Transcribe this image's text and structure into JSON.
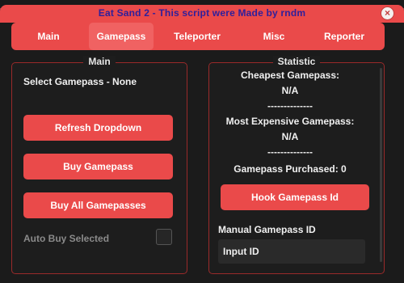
{
  "window": {
    "title": "Eat Sand 2 - This script were Made by rndm",
    "close_icon": "×"
  },
  "tabs": [
    {
      "label": "Main",
      "active": false
    },
    {
      "label": "Gamepass",
      "active": true
    },
    {
      "label": "Teleporter",
      "active": false
    },
    {
      "label": "Misc",
      "active": false
    },
    {
      "label": "Reporter",
      "active": false
    }
  ],
  "main_panel": {
    "title": "Main",
    "select_label": "Select Gamepass - None",
    "refresh_button": "Refresh Dropdown",
    "buy_button": "Buy Gamepass",
    "buy_all_button": "Buy All Gamepasses",
    "auto_buy_label": "Auto Buy Selected",
    "auto_buy_checked": false
  },
  "statistic_panel": {
    "title": "Statistic",
    "cheapest_label": "Cheapest Gamepass:",
    "cheapest_value": "N/A",
    "separator": "--------------",
    "most_expensive_label": "Most Expensive Gamepass:",
    "most_expensive_value": "N/A",
    "separator_2": "--------------",
    "purchased_label": "Gamepass Purchased: 0",
    "hook_button": "Hook Gamepass Id",
    "manual_label": "Manual Gamepass ID",
    "input_placeholder": "Input ID"
  },
  "colors": {
    "accent": "#ea4a4a",
    "title_text": "#2d1f9c",
    "background": "#1b1b1b"
  }
}
